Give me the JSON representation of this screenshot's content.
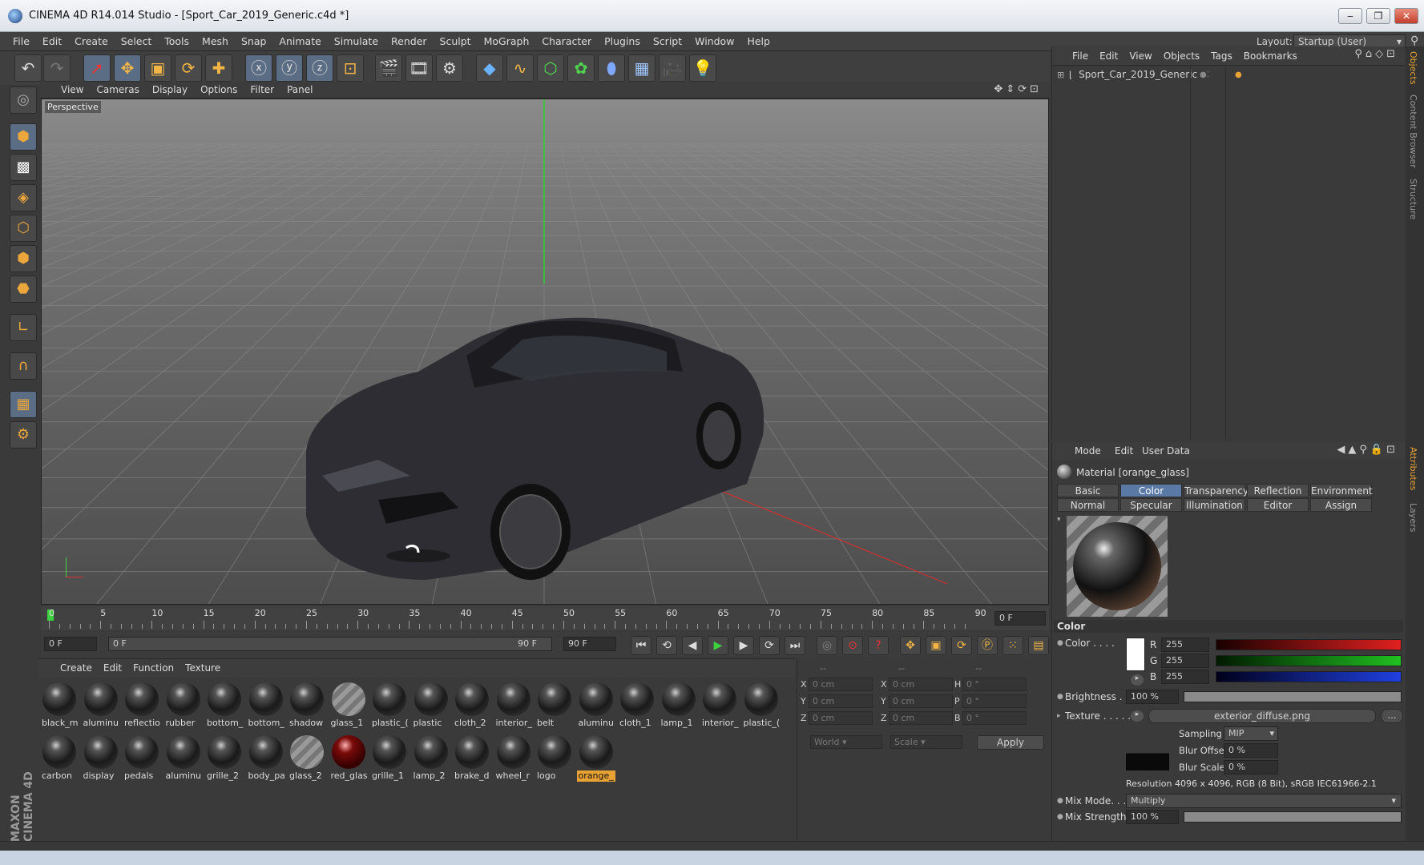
{
  "window": {
    "title": "CINEMA 4D R14.014 Studio - [Sport_Car_2019_Generic.c4d *]",
    "minimize": "‒",
    "maximize": "❐",
    "close": "✕"
  },
  "menu": [
    "File",
    "Edit",
    "Create",
    "Select",
    "Tools",
    "Mesh",
    "Snap",
    "Animate",
    "Simulate",
    "Render",
    "Sculpt",
    "MoGraph",
    "Character",
    "Plugins",
    "Script",
    "Window",
    "Help"
  ],
  "layout": {
    "label": "Layout:",
    "value": "Startup (User)"
  },
  "viewport": {
    "menu": [
      "View",
      "Cameras",
      "Display",
      "Options",
      "Filter",
      "Panel"
    ],
    "label": "Perspective"
  },
  "timeline": {
    "ticks": [
      "0",
      "5",
      "10",
      "15",
      "20",
      "25",
      "30",
      "35",
      "40",
      "45",
      "50",
      "55",
      "60",
      "65",
      "70",
      "75",
      "80",
      "85",
      "90"
    ],
    "current_frame": "0 F"
  },
  "controls": {
    "start_frame": "0 F",
    "range_start": "0 F",
    "range_end": "90 F",
    "end_frame": "90 F"
  },
  "materials": {
    "menu": [
      "Create",
      "Edit",
      "Function",
      "Texture"
    ],
    "row1": [
      "black_m",
      "aluminu",
      "reflectio",
      "rubber",
      "bottom_",
      "bottom_",
      "shadow",
      "glass_1",
      "plastic_(",
      "plastic",
      "cloth_2",
      "interior_",
      "belt",
      "aluminu",
      "cloth_1",
      "lamp_1",
      "interior_",
      "plastic_("
    ],
    "row2": [
      "carbon",
      "display",
      "pedals",
      "aluminu",
      "grille_2",
      "body_pa",
      "glass_2",
      "red_glas",
      "grille_1",
      "lamp_2",
      "brake_d",
      "wheel_r",
      "logo",
      "orange_"
    ]
  },
  "coords": {
    "headers": [
      "--",
      "--",
      "--"
    ],
    "rows": [
      {
        "a": "X",
        "av": "0 cm",
        "b": "X",
        "bv": "0 cm",
        "c": "H",
        "cv": "0 °"
      },
      {
        "a": "Y",
        "av": "0 cm",
        "b": "Y",
        "bv": "0 cm",
        "c": "P",
        "cv": "0 °"
      },
      {
        "a": "Z",
        "av": "0 cm",
        "b": "Z",
        "bv": "0 cm",
        "c": "B",
        "cv": "0 °"
      }
    ],
    "world": "World",
    "scale": "Scale",
    "apply": "Apply"
  },
  "objects": {
    "menu": [
      "File",
      "Edit",
      "View",
      "Objects",
      "Tags",
      "Bookmarks"
    ],
    "root": "Sport_Car_2019_Generic"
  },
  "attributes": {
    "menu": [
      "Mode",
      "Edit",
      "User Data"
    ],
    "material": "Material [orange_glass]",
    "tabs_row1": [
      "Basic",
      "Color",
      "Transparency",
      "Reflection",
      "Environment"
    ],
    "tabs_row2": [
      "Normal",
      "Specular",
      "Illumination",
      "Editor",
      "Assign"
    ],
    "section": "Color",
    "color_label": "Color . . . .",
    "r_label": "R",
    "r": "255",
    "g_label": "G",
    "g": "255",
    "b_label": "B",
    "b": "255",
    "brightness_label": "Brightness . .",
    "brightness": "100 %",
    "texture_label": "Texture . . . . .",
    "texture_file": "exterior_diffuse.png",
    "texture_more": "...",
    "sampling_label": "Sampling",
    "sampling": "MIP",
    "blur_offset_label": "Blur Offset",
    "blur_offset": "0 %",
    "blur_scale_label": "Blur Scale",
    "blur_scale": "0 %",
    "resolution": "Resolution 4096 x 4096, RGB (8 Bit), sRGB IEC61966-2.1",
    "mix_mode_label": "Mix Mode. . .",
    "mix_mode": "Multiply",
    "mix_strength_label": "Mix Strength",
    "mix_strength": "100 %"
  },
  "side_tabs": [
    "Objects",
    "Content Browser",
    "Structure",
    "Attributes",
    "Layers"
  ],
  "brand": "MAXON CINEMA 4D"
}
